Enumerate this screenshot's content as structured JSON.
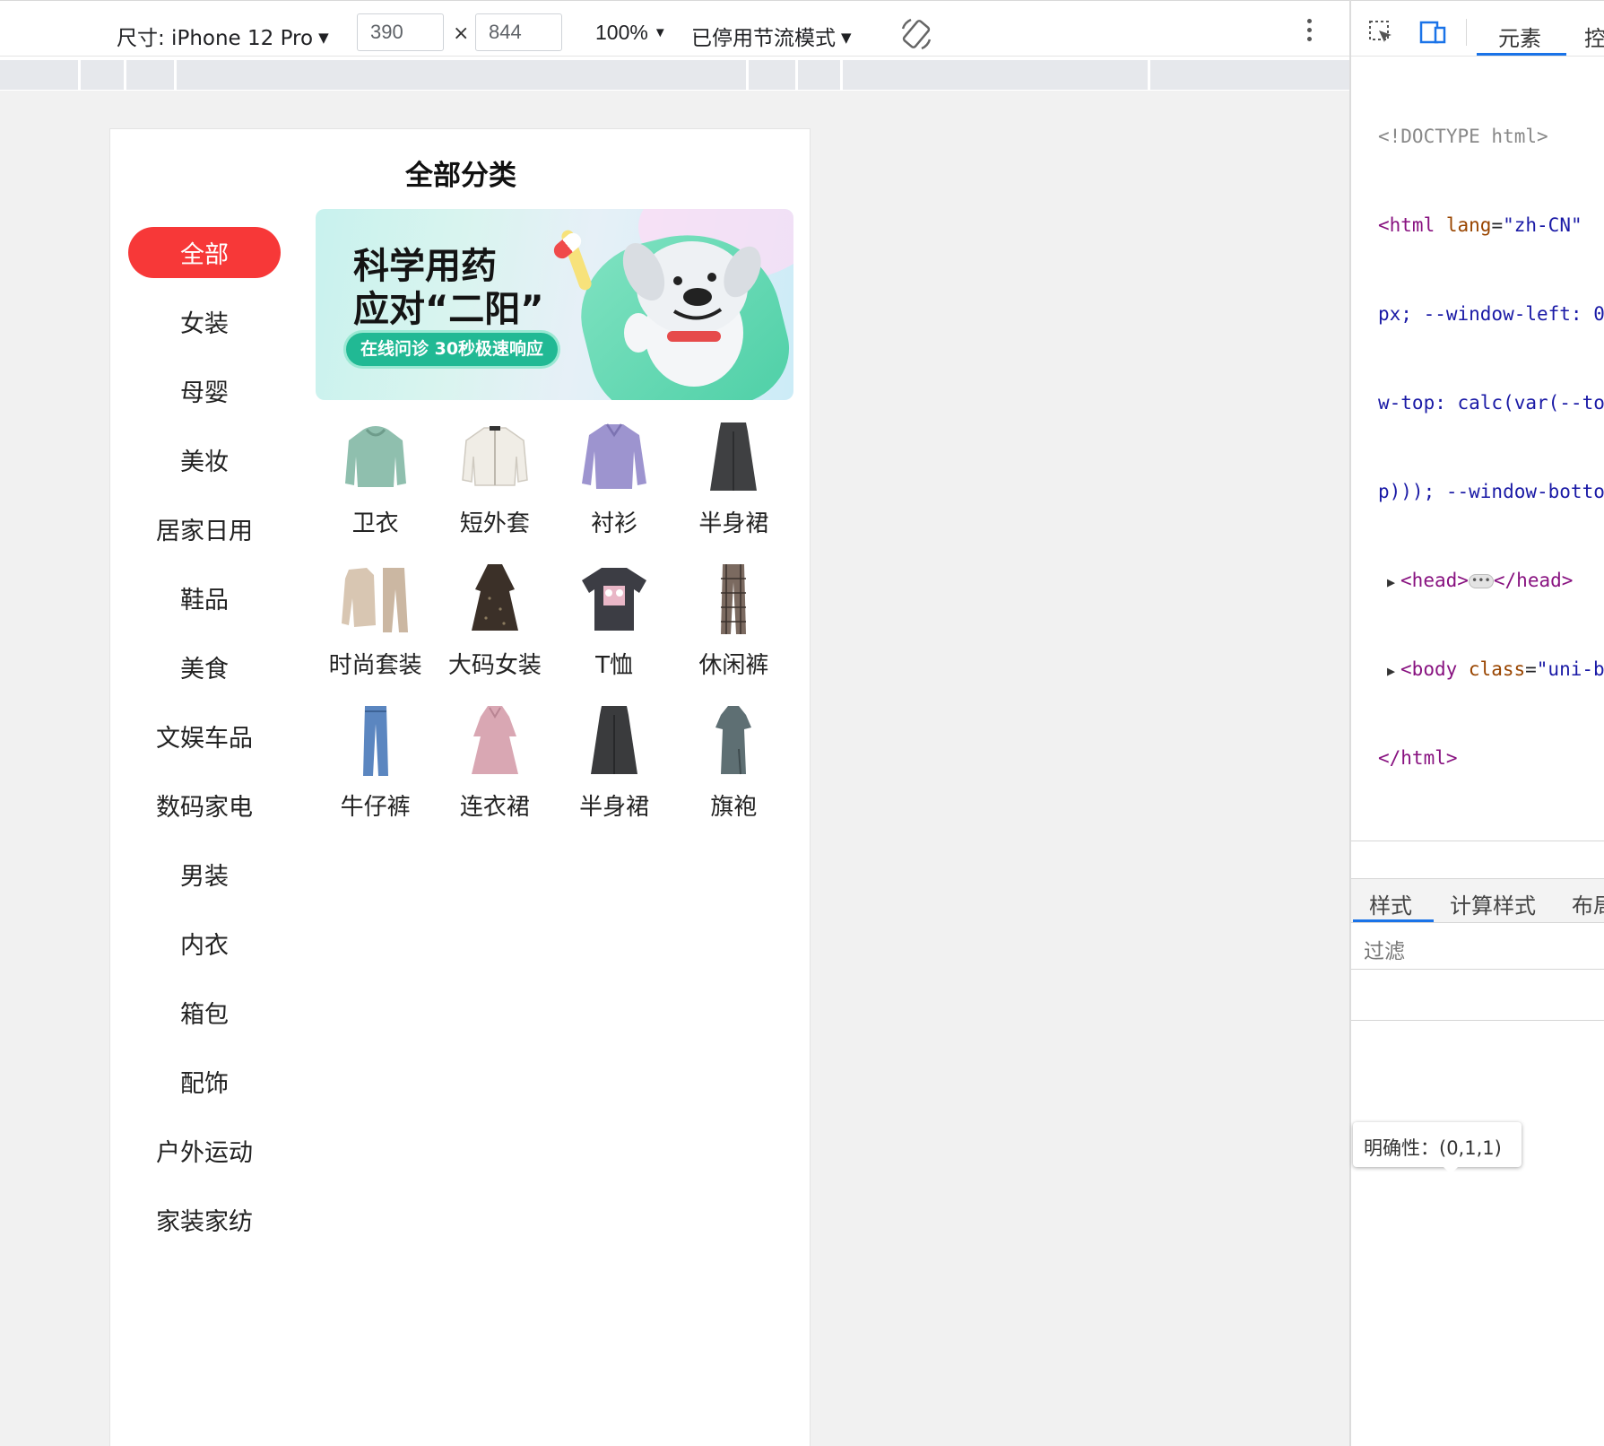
{
  "device_toolbar": {
    "device_label": "尺寸: iPhone 12 Pro",
    "width_value": "390",
    "times": "×",
    "height_value": "844",
    "zoom": "100%",
    "throttle": "已停用节流模式",
    "caret": "▼",
    "rotate_icon": "rotate-icon",
    "more_icon": "more-vertical-icon"
  },
  "page": {
    "title": "全部分类",
    "categories": [
      {
        "label": "全部",
        "active": true
      },
      {
        "label": "女装"
      },
      {
        "label": "母婴"
      },
      {
        "label": "美妆"
      },
      {
        "label": "居家日用"
      },
      {
        "label": "鞋品"
      },
      {
        "label": "美食"
      },
      {
        "label": "文娱车品"
      },
      {
        "label": "数码家电"
      },
      {
        "label": "男装"
      },
      {
        "label": "内衣"
      },
      {
        "label": "箱包"
      },
      {
        "label": "配饰"
      },
      {
        "label": "户外运动"
      },
      {
        "label": "家装家纺"
      }
    ],
    "banner": {
      "line1": "科学用药",
      "line2": "应对“二阳”",
      "pill": "在线问诊 30秒极速响应"
    },
    "items": [
      {
        "label": "卫衣",
        "icon": "hoodie-thumb",
        "color": "#8fbfae"
      },
      {
        "label": "短外套",
        "icon": "jacket-thumb",
        "color": "#f0ede6"
      },
      {
        "label": "衬衫",
        "icon": "shirt-thumb",
        "color": "#9d94cf"
      },
      {
        "label": "半身裙",
        "icon": "skirt-thumb",
        "color": "#3f4042"
      },
      {
        "label": "时尚套装",
        "icon": "suit-set-thumb",
        "color": "#d8c6b2"
      },
      {
        "label": "大码女装",
        "icon": "dress-thumb",
        "color": "#3b3028"
      },
      {
        "label": "T恤",
        "icon": "tshirt-thumb",
        "color": "#3c3d44"
      },
      {
        "label": "休闲裤",
        "icon": "pants-thumb",
        "color": "#7b6a60"
      },
      {
        "label": "牛仔裤",
        "icon": "jeans-thumb",
        "color": "#5b86c0"
      },
      {
        "label": "连衣裙",
        "icon": "dress-thumb",
        "color": "#d9a7b3"
      },
      {
        "label": "半身裙",
        "icon": "skirt-thumb",
        "color": "#3a3b3d"
      },
      {
        "label": "旗袍",
        "icon": "qipao-thumb",
        "color": "#5e6f73"
      }
    ]
  },
  "devtools": {
    "tab_elements": "元素",
    "tab_console": "控",
    "dom": {
      "doctype": "<!DOCTYPE html>",
      "html_open": "<html",
      "lang_attr": "lang",
      "lang_val": "\"zh-CN\"",
      "line2": "px; --window-left: 0",
      "line3": "w-top: calc(var(--to",
      "line4": "p))); --window-botto",
      "head_open": "<head>",
      "head_close": "</head>",
      "body_open": "<body",
      "class_attr": "class",
      "class_val": "\"uni-bo",
      "html_close": "</html>"
    },
    "styles_tab": "样式",
    "computed_tab": "计算样式",
    "layout_tab": "布局",
    "filter_placeholder": "过滤",
    "tooltip": "明确性：(0,1,1)"
  }
}
